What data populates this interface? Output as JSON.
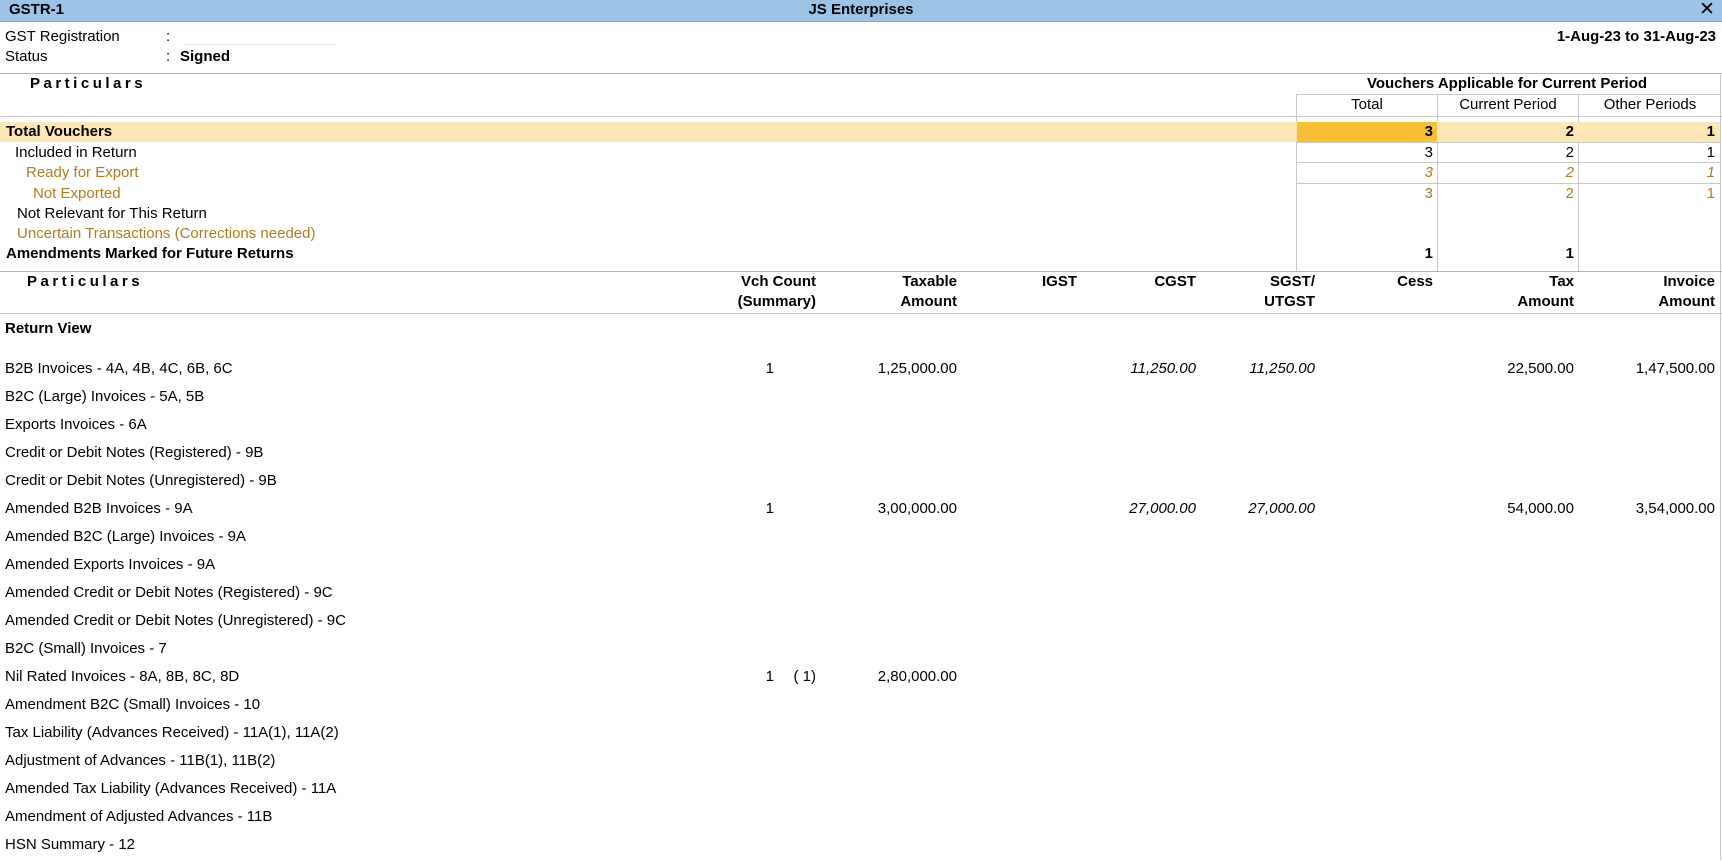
{
  "window": {
    "app_title": "GSTR-1",
    "company": "JS Enterprises",
    "close_glyph": "✕"
  },
  "header": {
    "gst_registration_label": "GST Registration",
    "status_label": "Status",
    "separator": ":",
    "status_value": "Signed",
    "period": "1-Aug-23 to 31-Aug-23"
  },
  "summary": {
    "particulars_header": "Particulars",
    "group_header": "Vouchers Applicable for Current Period",
    "col_total": "Total",
    "col_current": "Current Period",
    "col_other": "Other Periods",
    "rows": [
      {
        "label": "Total Vouchers",
        "total": "3",
        "current": "2",
        "other": "1"
      },
      {
        "label": "Included in Return",
        "total": "3",
        "current": "2",
        "other": "1"
      },
      {
        "label": "Ready for Export",
        "total": "3",
        "current": "2",
        "other": "1"
      },
      {
        "label": "Not Exported",
        "total": "3",
        "current": "2",
        "other": "1"
      },
      {
        "label": "Not Relevant for This Return",
        "total": "",
        "current": "",
        "other": ""
      },
      {
        "label": "Uncertain Transactions (Corrections needed)",
        "total": "",
        "current": "",
        "other": ""
      },
      {
        "label": "Amendments Marked for Future Returns",
        "total": "1",
        "current": "1",
        "other": ""
      }
    ]
  },
  "detail": {
    "particulars_header": "Particulars",
    "col_vch_count_1": "Vch Count",
    "col_vch_count_2": "(Summary)",
    "col_taxable_1": "Taxable",
    "col_taxable_2": "Amount",
    "col_igst": "IGST",
    "col_cgst": "CGST",
    "col_sgst_1": "SGST/",
    "col_sgst_2": "UTGST",
    "col_cess": "Cess",
    "col_tax_1": "Tax",
    "col_tax_2": "Amount",
    "col_invoice_1": "Invoice",
    "col_invoice_2": "Amount",
    "section_title": "Return View",
    "rows": [
      {
        "label": "B2B Invoices - 4A, 4B, 4C, 6B, 6C",
        "count": "1",
        "summary": "",
        "taxable": "1,25,000.00",
        "igst": "",
        "cgst": "11,250.00",
        "sgst": "11,250.00",
        "cess": "",
        "tax": "22,500.00",
        "invoice": "1,47,500.00"
      },
      {
        "label": "B2C (Large) Invoices - 5A, 5B",
        "count": "",
        "summary": "",
        "taxable": "",
        "igst": "",
        "cgst": "",
        "sgst": "",
        "cess": "",
        "tax": "",
        "invoice": ""
      },
      {
        "label": "Exports Invoices - 6A",
        "count": "",
        "summary": "",
        "taxable": "",
        "igst": "",
        "cgst": "",
        "sgst": "",
        "cess": "",
        "tax": "",
        "invoice": ""
      },
      {
        "label": "Credit or Debit Notes (Registered) - 9B",
        "count": "",
        "summary": "",
        "taxable": "",
        "igst": "",
        "cgst": "",
        "sgst": "",
        "cess": "",
        "tax": "",
        "invoice": ""
      },
      {
        "label": "Credit or Debit Notes (Unregistered) - 9B",
        "count": "",
        "summary": "",
        "taxable": "",
        "igst": "",
        "cgst": "",
        "sgst": "",
        "cess": "",
        "tax": "",
        "invoice": ""
      },
      {
        "label": "Amended B2B Invoices - 9A",
        "count": "1",
        "summary": "",
        "taxable": "3,00,000.00",
        "igst": "",
        "cgst": "27,000.00",
        "sgst": "27,000.00",
        "cess": "",
        "tax": "54,000.00",
        "invoice": "3,54,000.00"
      },
      {
        "label": "Amended B2C (Large) Invoices - 9A",
        "count": "",
        "summary": "",
        "taxable": "",
        "igst": "",
        "cgst": "",
        "sgst": "",
        "cess": "",
        "tax": "",
        "invoice": ""
      },
      {
        "label": "Amended Exports Invoices - 9A",
        "count": "",
        "summary": "",
        "taxable": "",
        "igst": "",
        "cgst": "",
        "sgst": "",
        "cess": "",
        "tax": "",
        "invoice": ""
      },
      {
        "label": "Amended Credit or Debit Notes (Registered) - 9C",
        "count": "",
        "summary": "",
        "taxable": "",
        "igst": "",
        "cgst": "",
        "sgst": "",
        "cess": "",
        "tax": "",
        "invoice": ""
      },
      {
        "label": "Amended Credit or Debit Notes (Unregistered) - 9C",
        "count": "",
        "summary": "",
        "taxable": "",
        "igst": "",
        "cgst": "",
        "sgst": "",
        "cess": "",
        "tax": "",
        "invoice": ""
      },
      {
        "label": "B2C (Small) Invoices - 7",
        "count": "",
        "summary": "",
        "taxable": "",
        "igst": "",
        "cgst": "",
        "sgst": "",
        "cess": "",
        "tax": "",
        "invoice": ""
      },
      {
        "label": "Nil Rated Invoices - 8A, 8B, 8C, 8D",
        "count": "1",
        "summary": "( 1)",
        "taxable": "2,80,000.00",
        "igst": "",
        "cgst": "",
        "sgst": "",
        "cess": "",
        "tax": "",
        "invoice": ""
      },
      {
        "label": "Amendment B2C (Small) Invoices - 10",
        "count": "",
        "summary": "",
        "taxable": "",
        "igst": "",
        "cgst": "",
        "sgst": "",
        "cess": "",
        "tax": "",
        "invoice": ""
      },
      {
        "label": "Tax Liability (Advances Received) - 11A(1), 11A(2)",
        "count": "",
        "summary": "",
        "taxable": "",
        "igst": "",
        "cgst": "",
        "sgst": "",
        "cess": "",
        "tax": "",
        "invoice": ""
      },
      {
        "label": "Adjustment of Advances - 11B(1), 11B(2)",
        "count": "",
        "summary": "",
        "taxable": "",
        "igst": "",
        "cgst": "",
        "sgst": "",
        "cess": "",
        "tax": "",
        "invoice": ""
      },
      {
        "label": "Amended Tax Liability (Advances Received) - 11A",
        "count": "",
        "summary": "",
        "taxable": "",
        "igst": "",
        "cgst": "",
        "sgst": "",
        "cess": "",
        "tax": "",
        "invoice": ""
      },
      {
        "label": "Amendment of Adjusted Advances - 11B",
        "count": "",
        "summary": "",
        "taxable": "",
        "igst": "",
        "cgst": "",
        "sgst": "",
        "cess": "",
        "tax": "",
        "invoice": ""
      },
      {
        "label": "HSN Summary - 12",
        "count": "",
        "summary": "",
        "taxable": "",
        "igst": "",
        "cgst": "",
        "sgst": "",
        "cess": "",
        "tax": "",
        "invoice": ""
      }
    ]
  }
}
